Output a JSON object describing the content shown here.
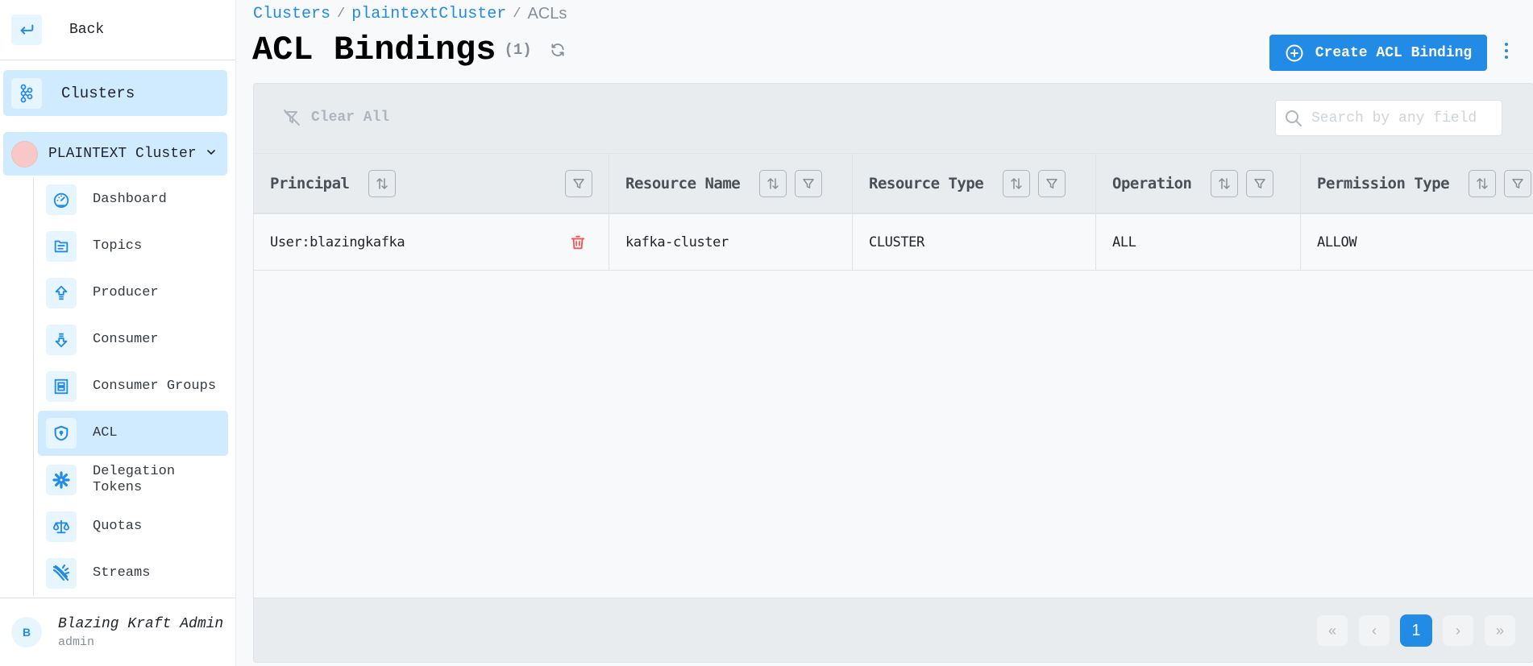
{
  "sidebar": {
    "back_label": "Back",
    "clusters_label": "Clusters",
    "cluster_name": "PLAINTEXT Cluster",
    "cluster_color": "#f8c8c8",
    "items": [
      {
        "label": "Dashboard",
        "icon": "gauge-icon"
      },
      {
        "label": "Topics",
        "icon": "folder-icon"
      },
      {
        "label": "Producer",
        "icon": "arrow-up-icon"
      },
      {
        "label": "Consumer",
        "icon": "arrow-down-icon"
      },
      {
        "label": "Consumer Groups",
        "icon": "box-icon"
      },
      {
        "label": "ACL",
        "icon": "shield-icon",
        "active": true
      },
      {
        "label": "Delegation Tokens",
        "icon": "asterisk-icon"
      },
      {
        "label": "Quotas",
        "icon": "scale-icon"
      },
      {
        "label": "Streams",
        "icon": "streams-icon"
      }
    ],
    "user": {
      "initial": "B",
      "name": "Blazing Kraft Admin",
      "role": "admin"
    }
  },
  "breadcrumb": [
    "Clusters",
    "plaintextCluster",
    "ACLs"
  ],
  "header": {
    "title": "ACL Bindings",
    "count": "(1)",
    "create_label": "Create ACL Binding"
  },
  "toolbar": {
    "clear_all_label": "Clear All",
    "search_placeholder": "Search by any field",
    "search_value": ""
  },
  "table": {
    "columns": [
      "Principal",
      "Resource Name",
      "Resource Type",
      "Operation",
      "Permission Type"
    ],
    "rows": [
      [
        "User:blazingkafka",
        "kafka-cluster",
        "CLUSTER",
        "ALL",
        "ALLOW"
      ]
    ]
  },
  "pagination": {
    "first": "«",
    "prev": "‹",
    "current": "1",
    "next": "›",
    "last": "»"
  },
  "colors": {
    "accent": "#228be6",
    "active_bg": "#d0ebff",
    "danger": "#fa5252"
  }
}
